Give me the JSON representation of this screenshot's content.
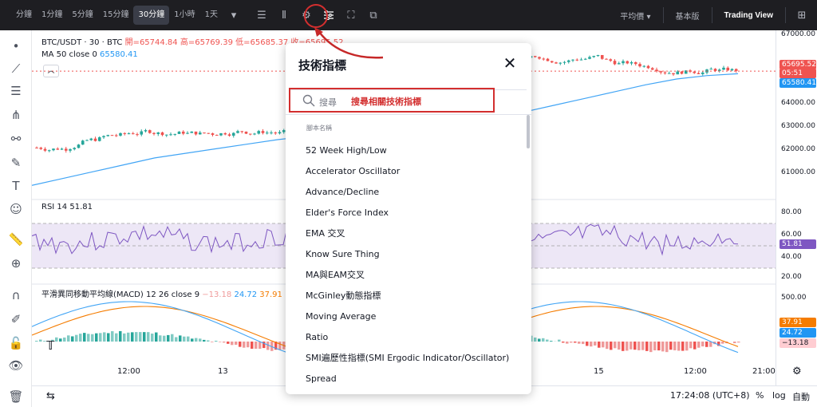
{
  "toolbar": {
    "timeframes": [
      "分鐘",
      "1分鐘",
      "5分鐘",
      "15分鐘",
      "30分鐘",
      "1小時",
      "1天"
    ],
    "active_timeframe": "30分鐘",
    "right_items": [
      "平均價",
      "基本版",
      "Trading View"
    ]
  },
  "legend": {
    "symbol": "BTC/USDT · 30 · BTC",
    "open_label": "開=65744.84",
    "high_label": "高=65769.39",
    "low_label": "低=65685.37",
    "close_label": "收=65695.52",
    "ma_label": "MA 50 close 0",
    "ma_value": "65580.41",
    "rsi_label": "RSI 14",
    "rsi_value": "51.81",
    "macd_label": "平滑異同移動平均線(MACD) 12 26 close 9",
    "macd_hist": "−13.18",
    "macd_line": "24.72",
    "macd_signal": "37.91"
  },
  "price_axis": {
    "ticks": [
      "67000.00",
      "66000.00",
      "64000.00",
      "63000.00",
      "62000.00",
      "61000.00"
    ],
    "rsi_ticks": [
      "80.00",
      "60.00",
      "40.00",
      "20.00"
    ],
    "macd_ticks": [
      "500.00"
    ],
    "last_price": "65695.52",
    "countdown": "05:51",
    "ma_price": "65580.41",
    "rsi_price": "51.81",
    "macd_signal_price": "37.91",
    "macd_line_price": "24.72",
    "macd_hist_price": "−13.18",
    "colors": {
      "last": "#ef5350",
      "ma": "#2196f3",
      "rsi": "#7e57c2",
      "signal": "#f57c00",
      "line": "#2196f3",
      "hist": "#ffcdd2"
    }
  },
  "time_axis": {
    "ticks": [
      "12:00",
      "13",
      "15",
      "12:00",
      "21:00"
    ]
  },
  "bottom_bar": {
    "time": "17:24:08 (UTC+8)",
    "percent": "%",
    "log": "log",
    "auto": "自動"
  },
  "dialog": {
    "title": "技術指標",
    "search_placeholder": "搜尋",
    "annotation": "搜尋相關技術指標",
    "section_label": "腳本名稱",
    "items": [
      "52 Week High/Low",
      "Accelerator Oscillator",
      "Advance/Decline",
      "Elder's Force Index",
      "EMA 交叉",
      "Know Sure Thing",
      "MA與EAM交叉",
      "McGinley動態指標",
      "Moving Average",
      "Ratio",
      "SMI遍歷性指標(SMI Ergodic Indicator/Oscillator)",
      "Spread"
    ]
  },
  "chart_data": {
    "type": "line",
    "title": "BTC/USDT · 30 · BTC",
    "series": [
      {
        "name": "MA 50 close 0",
        "values": [
          60700,
          61000,
          61300,
          61600,
          61900,
          62100,
          62300,
          62500,
          62700,
          62850,
          62950,
          63000,
          63050,
          63150,
          63350,
          63600,
          63900,
          64200,
          64500,
          64800,
          65100,
          65350,
          65500,
          65580
        ]
      }
    ],
    "ylim": [
      60500,
      67200
    ]
  }
}
